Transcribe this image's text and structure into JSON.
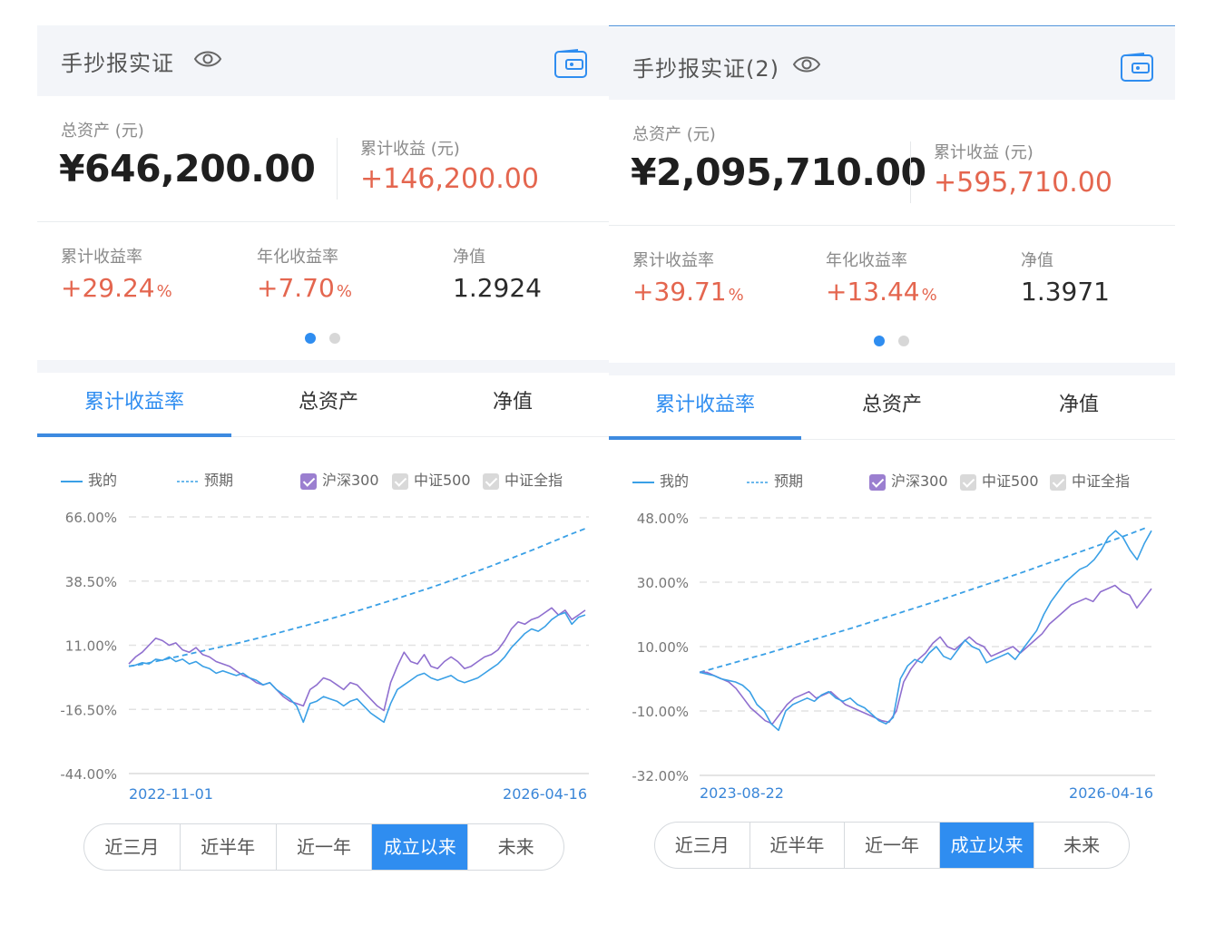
{
  "panels": [
    {
      "title": "手抄报实证",
      "total_label": "总资产 (元)",
      "total_value": "¥646,200.00",
      "gain_label": "累计收益 (元)",
      "gain_value": "+146,200.00",
      "stats": [
        {
          "label": "累计收益率",
          "value": "+29.24",
          "unit": "%"
        },
        {
          "label": "年化收益率",
          "value": "+7.70",
          "unit": "%"
        },
        {
          "label": "净值",
          "value": "1.2924",
          "unit": ""
        }
      ],
      "tabs": [
        "累计收益率",
        "总资产",
        "净值"
      ],
      "legend": {
        "mine": "我的",
        "expected": "预期",
        "idx1": "沪深300",
        "idx2": "中证500",
        "idx3": "中证全指"
      },
      "range_buttons": [
        "近三月",
        "近半年",
        "近一年",
        "成立以来",
        "未来"
      ],
      "active_range": "成立以来"
    },
    {
      "title": "手抄报实证(2)",
      "total_label": "总资产 (元)",
      "total_value": "¥2,095,710.00",
      "gain_label": "累计收益 (元)",
      "gain_value": "+595,710.00",
      "stats": [
        {
          "label": "累计收益率",
          "value": "+39.71",
          "unit": "%"
        },
        {
          "label": "年化收益率",
          "value": "+13.44",
          "unit": "%"
        },
        {
          "label": "净值",
          "value": "1.3971",
          "unit": ""
        }
      ],
      "tabs": [
        "累计收益率",
        "总资产",
        "净值"
      ],
      "legend": {
        "mine": "我的",
        "expected": "预期",
        "idx1": "沪深300",
        "idx2": "中证500",
        "idx3": "中证全指"
      },
      "range_buttons": [
        "近三月",
        "近半年",
        "近一年",
        "成立以来",
        "未来"
      ],
      "active_range": "成立以来"
    }
  ],
  "colors": {
    "accent": "#2f8df0",
    "gain": "#e4664f",
    "mine_line": "#3aa0e6",
    "index_line": "#8f6fcf",
    "expected_line": "#3aa0e6"
  },
  "chart_data": [
    {
      "type": "line",
      "y_ticks": [
        "66.00%",
        "38.50%",
        "11.00%",
        "-16.50%",
        "-44.00%"
      ],
      "ylim": [
        -44,
        66
      ],
      "x_start_label": "2022-11-01",
      "x_end_label": "2026-04-16",
      "series": [
        {
          "name": "我的",
          "values": [
            2.0,
            2.5,
            3.5,
            3.0,
            5.0,
            4.5,
            6.0,
            4.0,
            5.0,
            3.0,
            4.0,
            2.0,
            1.0,
            -1.0,
            0.0,
            -1.0,
            -2.0,
            -1.0,
            -3.0,
            -4.0,
            -6.0,
            -5.0,
            -8.0,
            -10.0,
            -12.0,
            -15.0,
            -22.0,
            -14.0,
            -13.0,
            -11.0,
            -12.0,
            -13.0,
            -15.0,
            -13.0,
            -12.0,
            -15.0,
            -18.0,
            -20.0,
            -22.0,
            -14.0,
            -8.0,
            -6.0,
            -4.0,
            -2.0,
            -1.0,
            -3.0,
            -4.0,
            -3.0,
            -2.0,
            -4.0,
            -5.0,
            -4.0,
            -3.0,
            -1.0,
            1.0,
            3.0,
            6.0,
            10.0,
            13.0,
            16.0,
            18.0,
            17.0,
            19.0,
            22.0,
            24.0,
            25.0,
            20.0,
            23.0,
            24.0
          ]
        },
        {
          "name": "沪深300",
          "values": [
            3.0,
            6.0,
            8.0,
            11.0,
            14.0,
            13.0,
            11.0,
            12.0,
            9.0,
            8.0,
            10.0,
            7.0,
            6.0,
            4.0,
            3.0,
            2.0,
            0.0,
            -2.0,
            -3.0,
            -5.0,
            -6.0,
            -5.0,
            -8.0,
            -11.0,
            -13.0,
            -14.0,
            -15.0,
            -8.0,
            -6.0,
            -3.0,
            -4.0,
            -6.0,
            -8.0,
            -5.0,
            -6.0,
            -9.0,
            -12.0,
            -15.0,
            -17.0,
            -5.0,
            2.0,
            8.0,
            4.0,
            3.0,
            7.0,
            2.0,
            1.0,
            4.0,
            6.0,
            4.0,
            1.0,
            2.0,
            4.0,
            6.0,
            7.0,
            9.0,
            13.0,
            18.0,
            21.0,
            20.0,
            22.0,
            23.0,
            25.0,
            27.0,
            24.0,
            26.0,
            22.0,
            24.0,
            26.0
          ]
        },
        {
          "name": "预期",
          "values": [
            2.0,
            3.0,
            4.5,
            6.0,
            7.5,
            9.0,
            10.5,
            12.0,
            13.7,
            15.4,
            17.2,
            19.0,
            20.8,
            22.7,
            24.7,
            26.7,
            28.8,
            30.9,
            33.1,
            35.3,
            37.6,
            40.0,
            42.4,
            44.9,
            47.5,
            50.1,
            52.8,
            55.6,
            58.4,
            61.0
          ]
        }
      ]
    },
    {
      "type": "line",
      "y_ticks": [
        "48.00%",
        "30.00%",
        "10.00%",
        "-10.00%",
        "-32.00%"
      ],
      "ylim": [
        -32,
        48
      ],
      "x_start_label": "2023-08-22",
      "x_end_label": "2026-04-16",
      "series": [
        {
          "name": "我的",
          "values": [
            0.0,
            -0.5,
            -1.0,
            -2.0,
            -2.5,
            -3.0,
            -4.0,
            -6.0,
            -10.0,
            -12.0,
            -16.0,
            -18.0,
            -12.0,
            -10.0,
            -9.0,
            -8.0,
            -9.0,
            -7.0,
            -6.0,
            -8.0,
            -9.0,
            -8.0,
            -10.0,
            -11.0,
            -13.0,
            -15.0,
            -16.0,
            -14.0,
            -2.0,
            2.0,
            4.0,
            3.0,
            6.0,
            8.0,
            5.0,
            4.0,
            7.0,
            10.0,
            8.0,
            7.0,
            3.0,
            4.0,
            5.0,
            6.0,
            4.0,
            7.0,
            10.0,
            13.0,
            18.0,
            22.0,
            25.0,
            28.0,
            30.0,
            32.0,
            33.0,
            35.0,
            38.0,
            42.0,
            44.0,
            42.0,
            38.0,
            35.0,
            40.0,
            44.0
          ]
        },
        {
          "name": "沪深300",
          "values": [
            0.0,
            0.0,
            -1.0,
            -2.0,
            -3.0,
            -5.0,
            -8.0,
            -11.0,
            -13.0,
            -15.0,
            -16.0,
            -13.0,
            -10.0,
            -8.0,
            -7.0,
            -6.0,
            -8.0,
            -7.0,
            -6.0,
            -8.0,
            -10.0,
            -11.0,
            -12.0,
            -13.0,
            -14.0,
            -15.0,
            -15.5,
            -12.0,
            -3.0,
            1.0,
            4.0,
            6.0,
            9.0,
            11.0,
            8.0,
            7.0,
            9.0,
            11.0,
            9.0,
            8.0,
            5.0,
            6.0,
            7.0,
            8.0,
            6.0,
            8.0,
            10.0,
            12.0,
            15.0,
            17.0,
            19.0,
            21.0,
            22.0,
            23.0,
            22.0,
            25.0,
            26.0,
            27.0,
            25.0,
            24.0,
            20.0,
            23.0,
            26.0
          ]
        },
        {
          "name": "预期",
          "values": [
            0.0,
            1.5,
            3.0,
            4.5,
            6.0,
            7.6,
            9.2,
            10.8,
            12.4,
            14.0,
            15.7,
            17.4,
            19.1,
            20.8,
            22.5,
            24.3,
            26.1,
            27.9,
            29.7,
            31.5,
            33.4,
            35.3,
            37.2,
            39.1,
            41.0,
            43.0,
            45.0
          ]
        }
      ]
    }
  ]
}
